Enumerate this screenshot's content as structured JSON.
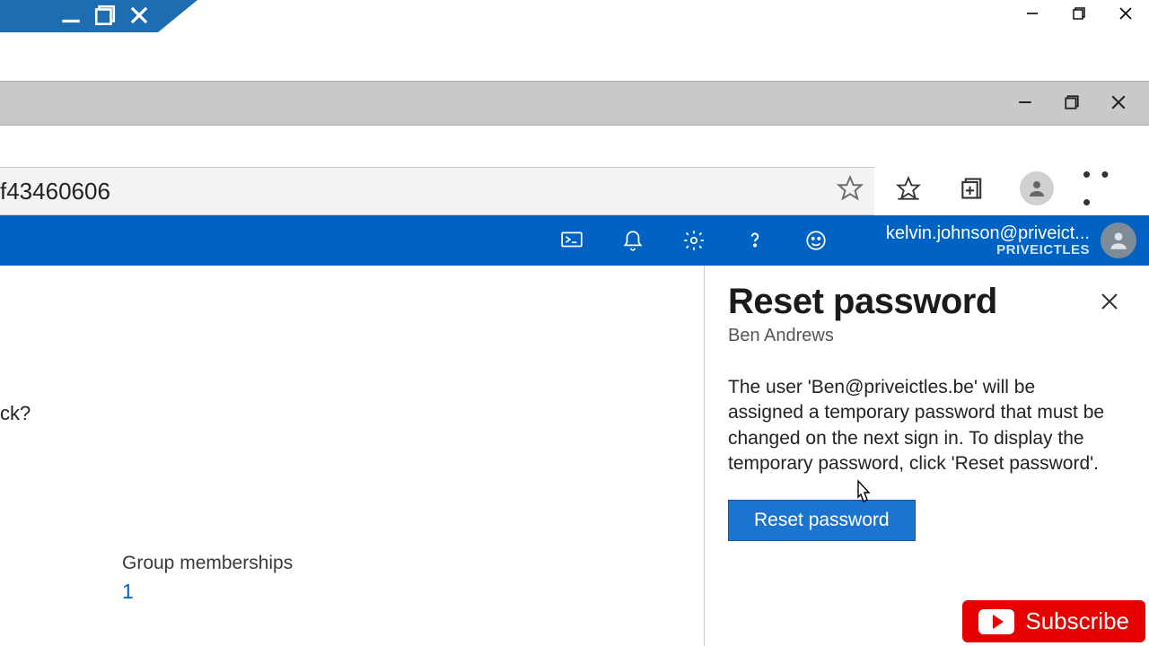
{
  "url_fragment": "f43460606",
  "azure": {
    "user_email": "kelvin.johnson@priveict...",
    "org": "PRIVEICTLES"
  },
  "left_col": {
    "truncated_text": "ck?",
    "group_label": "Group memberships",
    "group_count": "1"
  },
  "panel": {
    "title": "Reset password",
    "subtitle": "Ben Andrews",
    "description": "The user 'Ben@priveictles.be' will be assigned a temporary password that must be changed on the next sign in. To display the temporary password, click 'Reset password'.",
    "button": "Reset password"
  },
  "subscribe_label": "Subscribe"
}
